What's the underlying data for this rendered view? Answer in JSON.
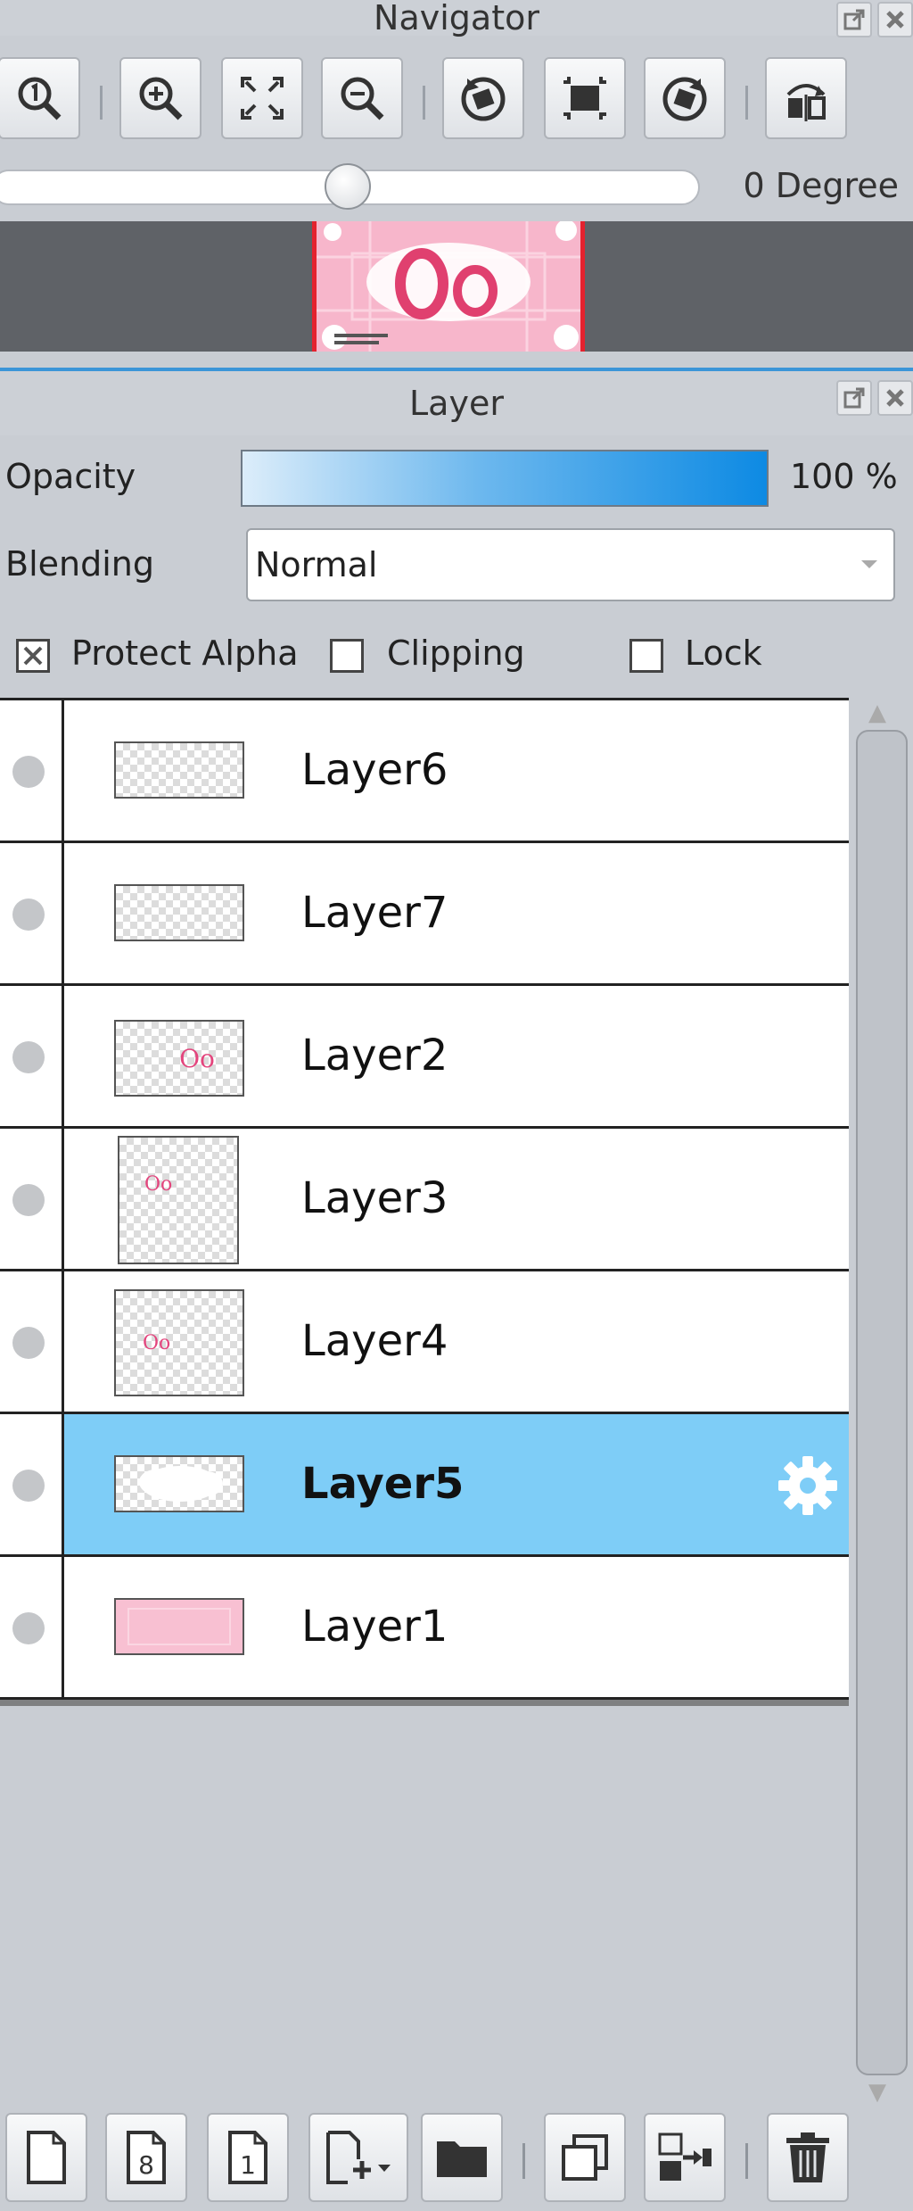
{
  "navigator": {
    "title": "Navigator",
    "rotation_label": "0 Degree",
    "tools": [
      "zoom-actual-icon",
      "zoom-in-icon",
      "fit-screen-icon",
      "zoom-out-icon",
      "rotate-left-icon",
      "reset-view-icon",
      "rotate-right-icon",
      "flip-horizontal-icon"
    ]
  },
  "layer_panel": {
    "title": "Layer",
    "opacity_label": "Opacity",
    "opacity_value": "100 %",
    "blending_label": "Blending",
    "blending_value": "Normal",
    "protect_alpha_label": "Protect Alpha",
    "protect_alpha_checked": true,
    "clipping_label": "Clipping",
    "clipping_checked": false,
    "lock_label": "Lock",
    "lock_checked": false,
    "layers": [
      {
        "name": "Layer6",
        "selected": false
      },
      {
        "name": "Layer7",
        "selected": false
      },
      {
        "name": "Layer2",
        "selected": false
      },
      {
        "name": "Layer3",
        "selected": false
      },
      {
        "name": "Layer4",
        "selected": false
      },
      {
        "name": "Layer5",
        "selected": true
      },
      {
        "name": "Layer1",
        "selected": false
      }
    ],
    "thumb_text": {
      "layer2": "Oo",
      "layer3": "Oo",
      "layer4": "Oo"
    },
    "bottom_tools": {
      "new_layer": "new-layer-icon",
      "new_layer_8bit": "8",
      "new_layer_1bit": "1",
      "add_layer_menu": "add-layer-menu-icon",
      "new_folder": "folder-icon",
      "duplicate": "duplicate-layer-icon",
      "merge": "merge-layer-icon",
      "delete": "trash-icon"
    }
  },
  "colors": {
    "accent_blue": "#3b95d8",
    "selected_row": "#7ecdf7",
    "canvas_pink": "#f7b6cb"
  }
}
